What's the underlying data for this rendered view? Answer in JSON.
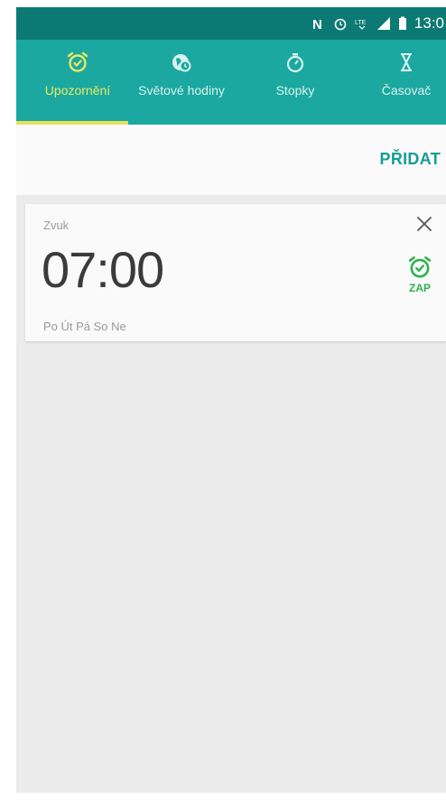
{
  "status_bar": {
    "time": "13:0",
    "icons": [
      "nfc-icon",
      "alarm-icon",
      "lte-icon",
      "signal-icon",
      "battery-icon"
    ]
  },
  "tabs": [
    {
      "label": "Upozornění",
      "icon": "alarm-clock-icon",
      "active": true
    },
    {
      "label": "Světové hodiny",
      "icon": "world-clock-icon",
      "active": false
    },
    {
      "label": "Stopky",
      "icon": "stopwatch-icon",
      "active": false
    },
    {
      "label": "Časovač",
      "icon": "hourglass-icon",
      "active": false
    }
  ],
  "actions": {
    "add_label": "PŘIDAT"
  },
  "alarm": {
    "name": "Zvuk",
    "time": "07:00",
    "days": "Po Út Pá So Ne",
    "toggle_label": "ZAP"
  },
  "colors": {
    "status_bar": "#0c7a74",
    "tab_bar": "#1ba8a0",
    "active_tab": "#e9ea61",
    "accent": "#169e96",
    "alarm_on": "#2bb24c"
  }
}
